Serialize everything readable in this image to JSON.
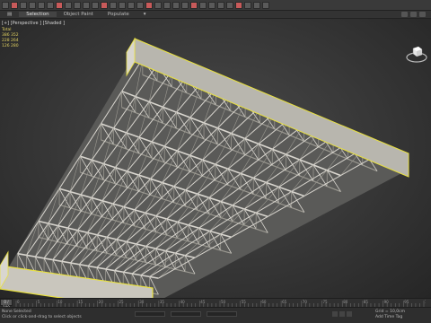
{
  "ribbon": {
    "tabs": [
      "Selection",
      "Object Paint",
      "Populate"
    ],
    "active_tab": 0
  },
  "toolbar": {
    "buttons": [
      "undo-icon",
      "redo-icon",
      "link-icon",
      "unlink-icon",
      "bind-icon",
      "selection-filter-icon",
      "select-object-icon",
      "select-by-name-icon",
      "rect-selection-icon",
      "window-crossing-icon",
      "move-icon",
      "rotate-icon",
      "scale-icon",
      "reference-coord-icon",
      "pivot-icon",
      "snap-toggle-icon",
      "angle-snap-icon",
      "percent-snap-icon",
      "spinner-snap-icon",
      "named-selection-icon",
      "mirror-icon",
      "align-icon",
      "layer-explorer-icon",
      "graphite-icon",
      "curve-editor-icon",
      "schematic-icon",
      "material-editor-icon",
      "render-setup-icon",
      "rendered-frame-icon",
      "render-icon"
    ],
    "accent_colors": [
      "#7a9ac8",
      "#c85a5a",
      "#b0b0b0",
      "#5fa05f",
      "#d0b040"
    ]
  },
  "viewport": {
    "label": "[+] [Perspective ] [Shaded ]",
    "stats": [
      "Total",
      "386 352",
      "228 264",
      "",
      "126 280"
    ]
  },
  "timeline": {
    "slider_label": "0 / 100",
    "tick_labels": [
      "0",
      "5",
      "10",
      "15",
      "20",
      "25",
      "30",
      "35",
      "40",
      "45",
      "50",
      "55",
      "60",
      "65",
      "70",
      "75",
      "80",
      "85",
      "90",
      "95",
      "100"
    ]
  },
  "status": {
    "line1": "None Selected",
    "line2": "Click or click-and-drag to select objects",
    "grid": "Grid = 10,0cm",
    "add_time_tag": "Add Time Tag"
  },
  "colors": {
    "selection_outline": "#e8e040",
    "truss": "#d9d6cf",
    "truss_shadow": "#9a9890"
  }
}
